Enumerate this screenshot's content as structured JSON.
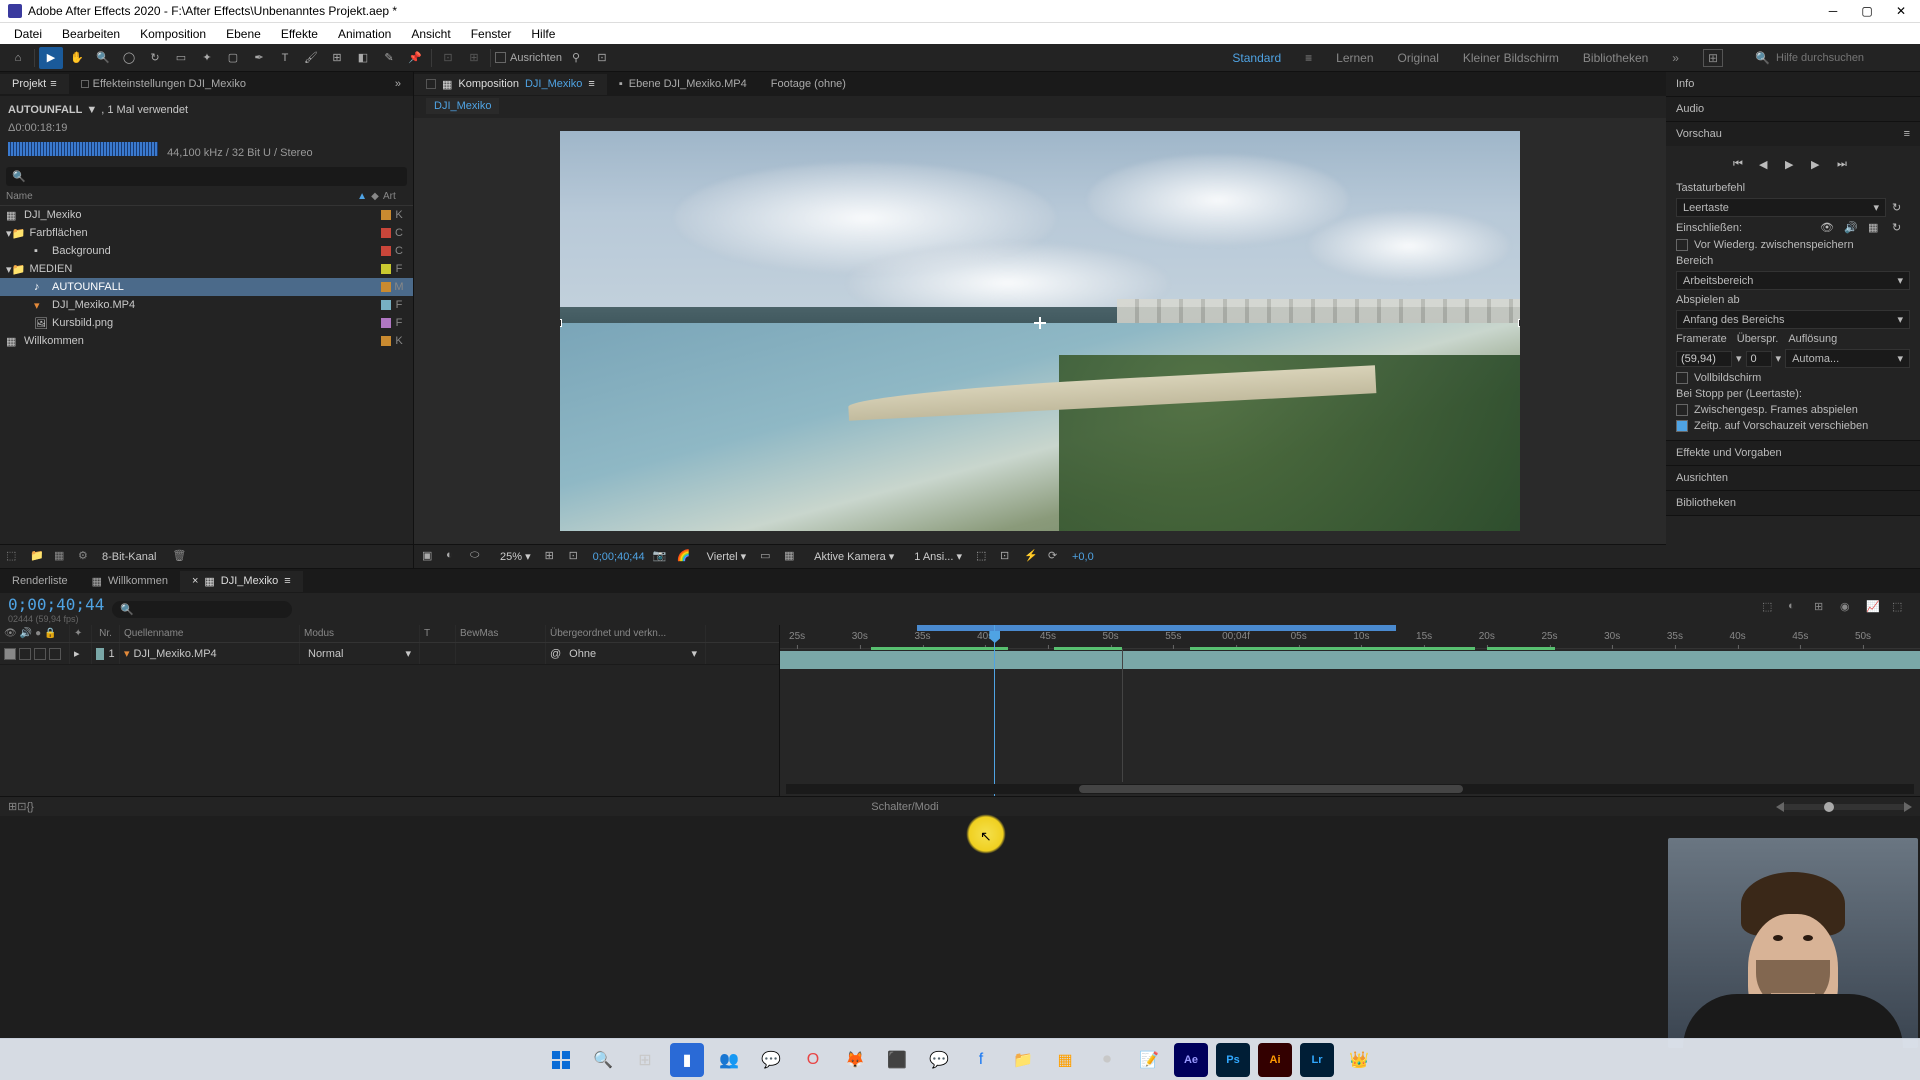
{
  "titlebar": {
    "text": "Adobe After Effects 2020 - F:\\After Effects\\Unbenanntes Projekt.aep *"
  },
  "menu": [
    "Datei",
    "Bearbeiten",
    "Komposition",
    "Ebene",
    "Effekte",
    "Animation",
    "Ansicht",
    "Fenster",
    "Hilfe"
  ],
  "toolbar": {
    "snap_label": "Ausrichten",
    "workspaces": [
      "Standard",
      "Lernen",
      "Original",
      "Kleiner Bildschirm",
      "Bibliotheken"
    ],
    "search_placeholder": "Hilfe durchsuchen"
  },
  "project": {
    "tab_project": "Projekt",
    "tab_effects": "Effekteinstellungen DJI_Mexiko",
    "asset_name": "AUTOUNFALL",
    "asset_usage": ", 1 Mal verwendet",
    "asset_duration": "Δ0:00:18:19",
    "asset_audio": "44,100 kHz / 32 Bit U / Stereo",
    "col_name": "Name",
    "col_type": "Art",
    "items": [
      {
        "name": "DJI_Mexiko",
        "indent": 0,
        "icon": "comp",
        "swatch": "#c98a30",
        "type": "K"
      },
      {
        "name": "Farbflächen",
        "indent": 0,
        "icon": "folder-open",
        "swatch": "#c9463a",
        "type": "C"
      },
      {
        "name": "Background",
        "indent": 1,
        "icon": "solid",
        "swatch": "#c9463a",
        "type": "C"
      },
      {
        "name": "MEDIEN",
        "indent": 0,
        "icon": "folder-open",
        "swatch": "#c9c930",
        "type": "F"
      },
      {
        "name": "AUTOUNFALL",
        "indent": 1,
        "icon": "audio",
        "swatch": "#c98a30",
        "type": "M",
        "selected": true
      },
      {
        "name": "DJI_Mexiko.MP4",
        "indent": 1,
        "icon": "video",
        "swatch": "#77b0c3",
        "type": "F"
      },
      {
        "name": "Kursbild.png",
        "indent": 1,
        "icon": "image",
        "swatch": "#b077c3",
        "type": "F"
      },
      {
        "name": "Willkommen",
        "indent": 0,
        "icon": "comp",
        "swatch": "#c98a30",
        "type": "K"
      }
    ],
    "footer_depth": "8-Bit-Kanal"
  },
  "comp": {
    "tab_comp_prefix": "Komposition",
    "tab_comp_name": "DJI_Mexiko",
    "tab_layer": "Ebene DJI_Mexiko.MP4",
    "tab_footage": "Footage (ohne)",
    "breadcrumb": "DJI_Mexiko",
    "zoom": "25%",
    "time": "0;00;40;44",
    "resolution": "Viertel",
    "camera": "Aktive Kamera",
    "views": "1 Ansi...",
    "exposure": "+0,0"
  },
  "right": {
    "info": "Info",
    "audio": "Audio",
    "preview": "Vorschau",
    "shortcut_label": "Tastaturbefehl",
    "shortcut_value": "Leertaste",
    "include_label": "Einschließen:",
    "cache_label": "Vor Wiederg. zwischenspeichern",
    "range_label": "Bereich",
    "range_value": "Arbeitsbereich",
    "playfrom_label": "Abspielen ab",
    "playfrom_value": "Anfang des Bereichs",
    "framerate_label": "Framerate",
    "framerate_value": "(59,94)",
    "skip_label": "Überspr.",
    "skip_value": "0",
    "res_label": "Auflösung",
    "res_value": "Automa...",
    "fullscreen_label": "Vollbildschirm",
    "onstop_label": "Bei Stopp per (Leertaste):",
    "cached_frames_label": "Zwischengesp. Frames abspielen",
    "move_time_label": "Zeitp. auf Vorschauzeit verschieben",
    "effects_presets": "Effekte und Vorgaben",
    "align": "Ausrichten",
    "libraries": "Bibliotheken"
  },
  "timeline": {
    "tab_render": "Renderliste",
    "tab_welcome": "Willkommen",
    "tab_comp": "DJI_Mexiko",
    "timecode": "0;00;40;44",
    "frames_sub": "02444 (59,94 fps)",
    "col_nr": "Nr.",
    "col_source": "Quellenname",
    "col_mode": "Modus",
    "col_t": "T",
    "col_trkmat": "BewMas",
    "col_parent": "Übergeordnet und verkn...",
    "layer_nr": "1",
    "layer_name": "DJI_Mexiko.MP4",
    "layer_mode": "Normal",
    "layer_parent": "Ohne",
    "ticks": [
      "25s",
      "30s",
      "35s",
      "40s",
      "45s",
      "50s",
      "55s",
      "00;04f",
      "05s",
      "10s",
      "15s",
      "20s",
      "25s",
      "30s",
      "35s",
      "40s",
      "45s",
      "50s"
    ],
    "switch_label": "Schalter/Modi"
  },
  "taskbar": [
    "windows",
    "search",
    "taskview",
    "explorer1",
    "teams",
    "whatsapp",
    "opera",
    "firefox",
    "app1",
    "messenger",
    "facebook",
    "files",
    "app2",
    "obs",
    "notepad",
    "ae",
    "ps",
    "ai",
    "lr",
    "app3"
  ]
}
